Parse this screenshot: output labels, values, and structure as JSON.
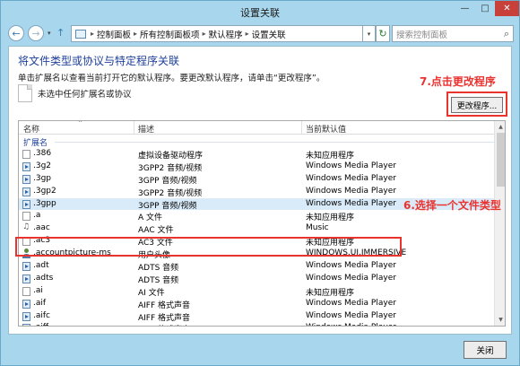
{
  "window": {
    "title": "设置关联",
    "minimize_glyph": "—",
    "maximize_glyph": "□",
    "close_glyph": "✕"
  },
  "nav": {
    "back_glyph": "←",
    "forward_glyph": "→",
    "dropdown_glyph": "▾",
    "up_glyph": "↑",
    "breadcrumb": [
      "控制面板",
      "所有控制面板项",
      "默认程序",
      "设置关联"
    ],
    "separator": "▸",
    "address_dropdown_glyph": "▾",
    "refresh_glyph": "↻",
    "search_placeholder": "搜索控制面板",
    "search_glyph": "⌕"
  },
  "main": {
    "heading": "将文件类型或协议与特定程序关联",
    "description": "单击扩展名以查看当前打开它的默认程序。要更改默认程序，请单击“更改程序”。",
    "no_selection": "未选中任何扩展名或协议",
    "change_program_button": "更改程序...",
    "annotation_step7": "7.点击更改程序",
    "annotation_step6": "6.选择一个文件类型"
  },
  "table": {
    "columns": [
      "名称",
      "描述",
      "当前默认值"
    ],
    "sort_glyph": "^",
    "group_label": "扩展名",
    "scroll_up_glyph": "▲",
    "scroll_down_glyph": "▼",
    "rows": [
      {
        "name": ".386",
        "desc": "虚拟设备驱动程序",
        "program": "未知应用程序",
        "icon": "file"
      },
      {
        "name": ".3g2",
        "desc": "3GPP2 音频/视频",
        "program": "Windows Media Player",
        "icon": "wmp"
      },
      {
        "name": ".3gp",
        "desc": "3GPP 音频/视频",
        "program": "Windows Media Player",
        "icon": "wmp"
      },
      {
        "name": ".3gp2",
        "desc": "3GPP2 音频/视频",
        "program": "Windows Media Player",
        "icon": "wmp"
      },
      {
        "name": ".3gpp",
        "desc": "3GPP 音频/视频",
        "program": "Windows Media Player",
        "icon": "wmp"
      },
      {
        "name": ".a",
        "desc": "A 文件",
        "program": "未知应用程序",
        "icon": "file"
      },
      {
        "name": ".aac",
        "desc": "AAC 文件",
        "program": "Music",
        "icon": "music"
      },
      {
        "name": ".ac3",
        "desc": "AC3 文件",
        "program": "未知应用程序",
        "icon": "file"
      },
      {
        "name": ".accountpicture-ms",
        "desc": "用户头像",
        "program": "WINDOWS.UI.IMMERSIVE",
        "icon": "user"
      },
      {
        "name": ".adt",
        "desc": "ADTS 音频",
        "program": "Windows Media Player",
        "icon": "wmp"
      },
      {
        "name": ".adts",
        "desc": "ADTS 音频",
        "program": "Windows Media Player",
        "icon": "wmp"
      },
      {
        "name": ".ai",
        "desc": "AI 文件",
        "program": "未知应用程序",
        "icon": "file"
      },
      {
        "name": ".aif",
        "desc": "AIFF 格式声音",
        "program": "Windows Media Player",
        "icon": "wmp"
      },
      {
        "name": ".aifc",
        "desc": "AIFF 格式声音",
        "program": "Windows Media Player",
        "icon": "wmp"
      },
      {
        "name": ".aiff",
        "desc": "AIFF 格式声音",
        "program": "Windows Media Player",
        "icon": "wmp"
      }
    ]
  },
  "footer": {
    "close_button": "关闭"
  }
}
